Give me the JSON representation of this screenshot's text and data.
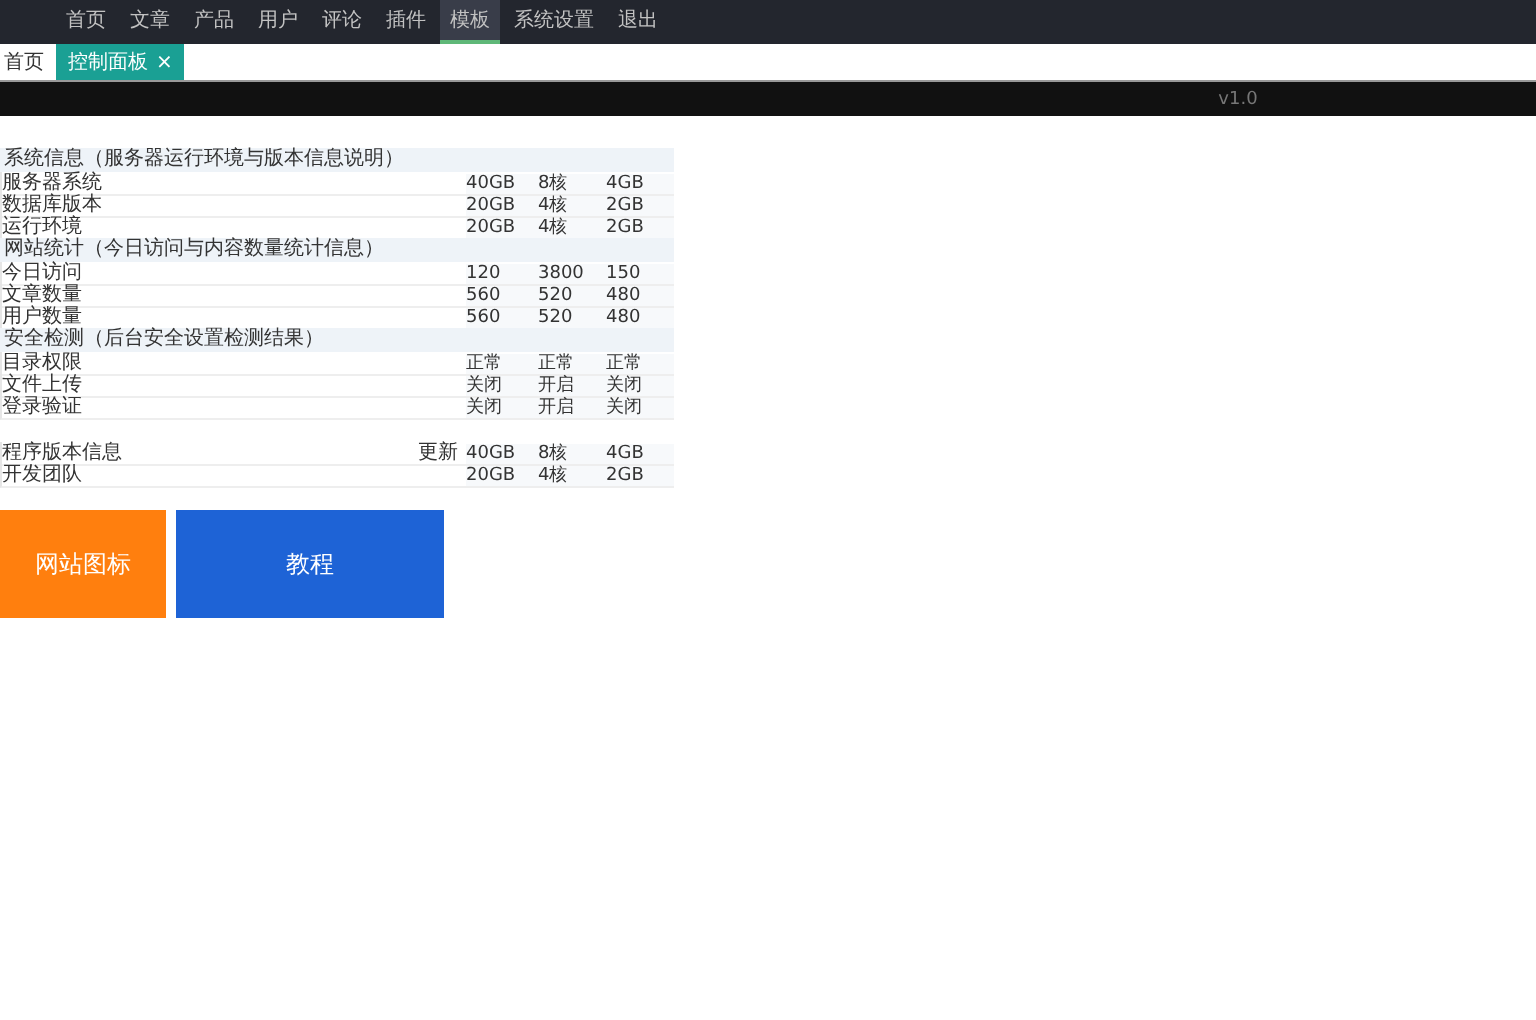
{
  "nav": [
    {
      "label": "首页",
      "selected": false
    },
    {
      "label": "文章",
      "selected": false
    },
    {
      "label": "产品",
      "selected": false
    },
    {
      "label": "用户",
      "selected": false
    },
    {
      "label": "评论",
      "selected": false
    },
    {
      "label": "插件",
      "selected": false
    },
    {
      "label": "模板",
      "selected": true
    },
    {
      "label": "系统设置",
      "selected": false
    },
    {
      "label": "退出",
      "selected": false
    }
  ],
  "tab_bar": {
    "home": "首页",
    "tabs": [
      {
        "label": "控制面板",
        "close": "×",
        "selected": true
      }
    ]
  },
  "status_bar": {
    "text": "v1.0"
  },
  "sections": [
    {
      "title": "系统信息（服务器运行环境与版本信息说明）",
      "rows": [
        {
          "label": "服务器系统",
          "cells": [
            "40GB",
            "8核",
            "4GB"
          ]
        },
        {
          "label": "数据库版本",
          "cells": [
            "20GB",
            "4核",
            "2GB"
          ]
        },
        {
          "label": "运行环境",
          "cells": [
            "20GB",
            "4核",
            "2GB"
          ]
        }
      ]
    },
    {
      "title": "网站统计（今日访问与内容数量统计信息）",
      "rows": [
        {
          "label": "今日访问",
          "cells": [
            "120",
            "3800",
            "150"
          ]
        },
        {
          "label": "文章数量",
          "cells": [
            "560",
            "520",
            "480"
          ]
        },
        {
          "label": "用户数量",
          "cells": [
            "560",
            "520",
            "480"
          ]
        }
      ]
    },
    {
      "title": "安全检测（后台安全设置检测结果）",
      "rows": [
        {
          "label": "目录权限",
          "cells": [
            "正常",
            "正常",
            "正常"
          ]
        },
        {
          "label": "文件上传",
          "cells": [
            "关闭",
            "开启",
            "关闭"
          ]
        },
        {
          "label": "登录验证",
          "cells": [
            "关闭",
            "开启",
            "关闭"
          ]
        }
      ]
    },
    {
      "rows": [
        {
          "label": "程序版本信息",
          "note": "更新",
          "cells": [
            "40GB",
            "8核",
            "4GB"
          ]
        },
        {
          "label": "开发团队",
          "cells": [
            "20GB",
            "4核",
            "2GB"
          ]
        }
      ]
    }
  ],
  "buttons": [
    {
      "label": "网站图标",
      "color": "#ff7f0e"
    },
    {
      "label": "教程",
      "color": "#1e63d6"
    }
  ]
}
